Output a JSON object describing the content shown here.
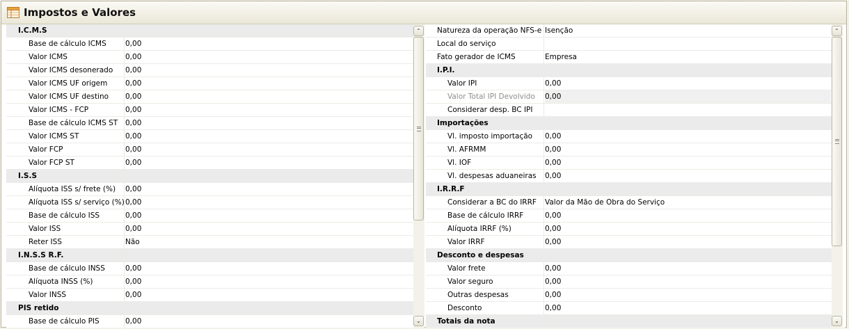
{
  "window": {
    "title": "Impostos e Valores"
  },
  "left_panel": {
    "rows": [
      {
        "label": "I.C.M.S",
        "value": "",
        "category": true
      },
      {
        "label": "Base de cálculo ICMS",
        "value": "0,00"
      },
      {
        "label": "Valor ICMS",
        "value": "0,00"
      },
      {
        "label": "Valor ICMS desonerado",
        "value": "0,00"
      },
      {
        "label": "Valor ICMS UF origem",
        "value": "0,00"
      },
      {
        "label": "Valor ICMS UF destino",
        "value": "0,00"
      },
      {
        "label": "Valor ICMS - FCP",
        "value": "0,00"
      },
      {
        "label": "Base de cálculo ICMS ST",
        "value": "0,00"
      },
      {
        "label": "Valor ICMS ST",
        "value": "0,00"
      },
      {
        "label": "Valor FCP",
        "value": "0,00"
      },
      {
        "label": "Valor FCP ST",
        "value": "0,00"
      },
      {
        "label": "I.S.S",
        "value": "",
        "category": true
      },
      {
        "label": "Alíquota ISS s/ frete (%)",
        "value": "0,00"
      },
      {
        "label": "Alíquota ISS s/ serviço (%)",
        "value": "0,00"
      },
      {
        "label": "Base de cálculo ISS",
        "value": "0,00"
      },
      {
        "label": "Valor ISS",
        "value": "0,00"
      },
      {
        "label": "Reter ISS",
        "value": "Não"
      },
      {
        "label": "I.N.S.S R.F.",
        "value": "",
        "category": true
      },
      {
        "label": "Base de cálculo INSS",
        "value": "0,00"
      },
      {
        "label": "Alíquota INSS (%)",
        "value": "0,00"
      },
      {
        "label": "Valor INSS",
        "value": "0,00"
      },
      {
        "label": "PIS retido",
        "value": "",
        "category": true
      },
      {
        "label": "Base de cálculo PIS",
        "value": "0,00"
      }
    ]
  },
  "right_panel": {
    "rows": [
      {
        "label": "Natureza da operação NFS-e",
        "value": "Isenção",
        "top": true
      },
      {
        "label": "Local do serviço",
        "value": "",
        "top": true
      },
      {
        "label": "Fato gerador de ICMS",
        "value": "Empresa",
        "top": true
      },
      {
        "label": "I.P.I.",
        "value": "",
        "category": true
      },
      {
        "label": "Valor IPI",
        "value": "0,00"
      },
      {
        "label": "Valor Total IPI Devolvido",
        "value": "0,00",
        "disabled": true
      },
      {
        "label": "Considerar desp. BC IPI",
        "value": ""
      },
      {
        "label": "Importações",
        "value": "",
        "category": true
      },
      {
        "label": "Vl. imposto importação",
        "value": "0,00"
      },
      {
        "label": "Vl. AFRMM",
        "value": "0,00"
      },
      {
        "label": "Vl. IOF",
        "value": "0,00"
      },
      {
        "label": "Vl. despesas aduaneiras",
        "value": "0,00"
      },
      {
        "label": "I.R.R.F",
        "value": "",
        "category": true
      },
      {
        "label": "Considerar a BC do IRRF",
        "value": "Valor da Mão de Obra do Serviço"
      },
      {
        "label": "Base de cálculo IRRF",
        "value": "0,00"
      },
      {
        "label": "Alíquota IRRF (%)",
        "value": "0,00"
      },
      {
        "label": "Valor IRRF",
        "value": "0,00"
      },
      {
        "label": "Desconto e despesas",
        "value": "",
        "category": true
      },
      {
        "label": "Valor frete",
        "value": "0,00"
      },
      {
        "label": "Valor seguro",
        "value": "0,00"
      },
      {
        "label": "Outras despesas",
        "value": "0,00"
      },
      {
        "label": "Desconto",
        "value": "0,00"
      },
      {
        "label": "Totais da nota",
        "value": "",
        "category": true
      }
    ]
  },
  "scrollbars": {
    "up_glyph": "⌃",
    "down_glyph": "⌄"
  }
}
